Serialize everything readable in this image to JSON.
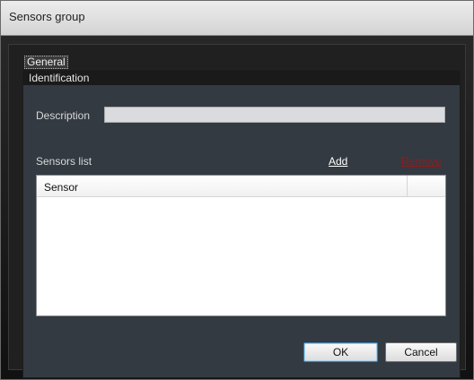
{
  "window": {
    "title": "Sensors group"
  },
  "tabs": [
    {
      "label": "General"
    }
  ],
  "group": {
    "header": "Identification"
  },
  "description": {
    "label": "Description",
    "value": ""
  },
  "sensors_list": {
    "label": "Sensors list",
    "add_label": "Add",
    "remove_label": "Remove",
    "columns": [
      "Sensor"
    ],
    "rows": []
  },
  "buttons": {
    "ok": "OK",
    "cancel": "Cancel"
  }
}
